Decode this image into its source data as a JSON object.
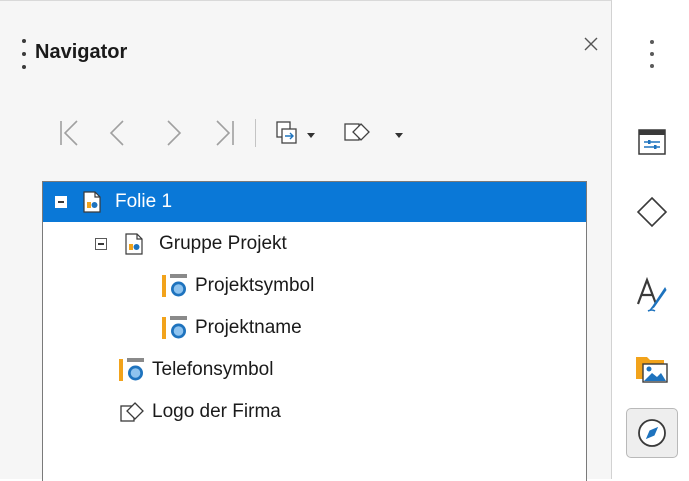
{
  "navigator": {
    "title": "Navigator",
    "toolbar": {
      "icons": [
        "first-icon",
        "previous-icon",
        "next-icon",
        "last-icon",
        "drag-mode-icon",
        "shapes-icon"
      ]
    },
    "tree": [
      {
        "label": "Folie 1",
        "icon": "slide-icon",
        "selected": true,
        "expanded": true
      },
      {
        "label": "Gruppe Projekt",
        "icon": "slide-icon",
        "expanded": true
      },
      {
        "label": "Projektsymbol",
        "icon": "object-icon"
      },
      {
        "label": "Projektname",
        "icon": "object-icon"
      },
      {
        "label": "Telefonsymbol",
        "icon": "object-icon"
      },
      {
        "label": "Logo der Firma",
        "icon": "shapes-icon"
      }
    ]
  },
  "sidebar": {
    "items": [
      "properties-icon",
      "shapes-icon",
      "styles-icon",
      "gallery-icon",
      "navigator-icon"
    ],
    "active": "navigator-icon"
  },
  "colors": {
    "selection": "#0a78d7",
    "accent_orange": "#f2a31b",
    "accent_blue": "#1e73be"
  }
}
